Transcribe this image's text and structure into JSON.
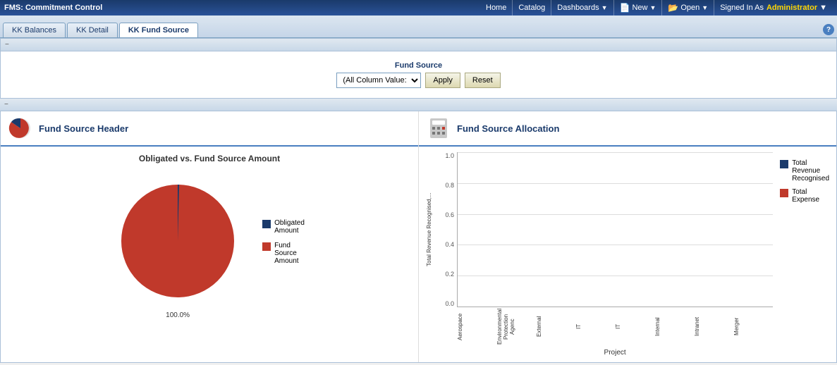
{
  "topbar": {
    "title": "FMS: Commitment Control",
    "nav_home": "Home",
    "nav_catalog": "Catalog",
    "nav_dashboards": "Dashboards",
    "nav_new": "New",
    "nav_open": "Open",
    "signed_in_label": "Signed In As",
    "signed_in_user": "Administrator"
  },
  "tabs": {
    "items": [
      {
        "label": "KK Balances",
        "active": false
      },
      {
        "label": "KK Detail",
        "active": false
      },
      {
        "label": "KK Fund Source",
        "active": true
      }
    ]
  },
  "filter": {
    "label": "Fund Source",
    "select_value": "(All Column Value:)",
    "apply_label": "Apply",
    "reset_label": "Reset"
  },
  "panels": {
    "left": {
      "title": "Fund Source Header",
      "chart_title": "Obligated vs. Fund Source Amount",
      "pie_percent": "100.0%",
      "legend": [
        {
          "label": "Obligated Amount",
          "color": "#1a3a6b"
        },
        {
          "label": "Fund Source Amount",
          "color": "#c0392b"
        }
      ]
    },
    "right": {
      "title": "Fund Source Allocation",
      "y_axis_label": "Total Revenue Recognised,...",
      "y_ticks": [
        "1.0",
        "0.8",
        "0.6",
        "0.4",
        "0.2",
        "0.0"
      ],
      "x_labels": [
        "Aerospace",
        "Environmental Protection Agenc",
        "External",
        "IT",
        "IT",
        "Internal",
        "Intranet",
        "Merger"
      ],
      "x_axis_title": "Project",
      "legend": [
        {
          "label": "Total Revenue Recognised",
          "color": "#1a3a6b"
        },
        {
          "label": "Total Expense",
          "color": "#c0392b"
        }
      ]
    }
  },
  "icons": {
    "collapse": "−",
    "help": "?",
    "new_icon": "📄",
    "open_icon": "📂",
    "pie_icon": "🥧",
    "calc_icon": "🧮"
  }
}
